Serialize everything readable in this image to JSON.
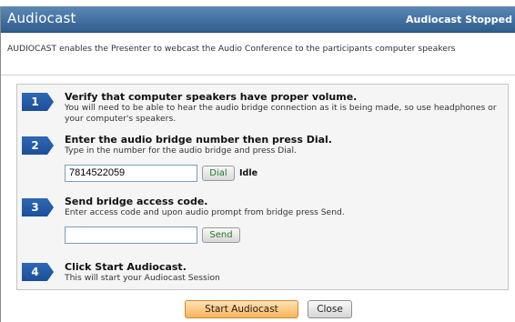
{
  "window": {
    "top_partial_text": "",
    "title": "Audiocast",
    "status": "Audiocast Stopped"
  },
  "intro": "AUDIOCAST enables the Presenter to webcast the Audio Conference to the participants computer speakers",
  "steps": [
    {
      "number": "1",
      "title": "Verify that computer speakers have proper volume.",
      "desc": "You will need to be able to hear the audio bridge connection as it is being made, so use headphones or your computer's speakers."
    },
    {
      "number": "2",
      "title": "Enter the audio bridge number then press Dial.",
      "desc": "Type in the number for the audio bridge and press Dial.",
      "input_value": "7814522059",
      "button_label": "Dial",
      "state_label": "Idle"
    },
    {
      "number": "3",
      "title": "Send bridge access code.",
      "desc": "Enter access code and upon audio prompt from bridge press Send.",
      "input_value": "",
      "button_label": "Send"
    },
    {
      "number": "4",
      "title": "Click Start Audiocast.",
      "desc": "This will start your Audiocast Session"
    }
  ],
  "footer": {
    "start_label": "Start Audiocast",
    "close_label": "Close"
  },
  "colors": {
    "titlebar": "#2f5e8f",
    "badge": "#1c4f98",
    "primary_button": "#f8b45c",
    "link_green": "#237a23"
  }
}
